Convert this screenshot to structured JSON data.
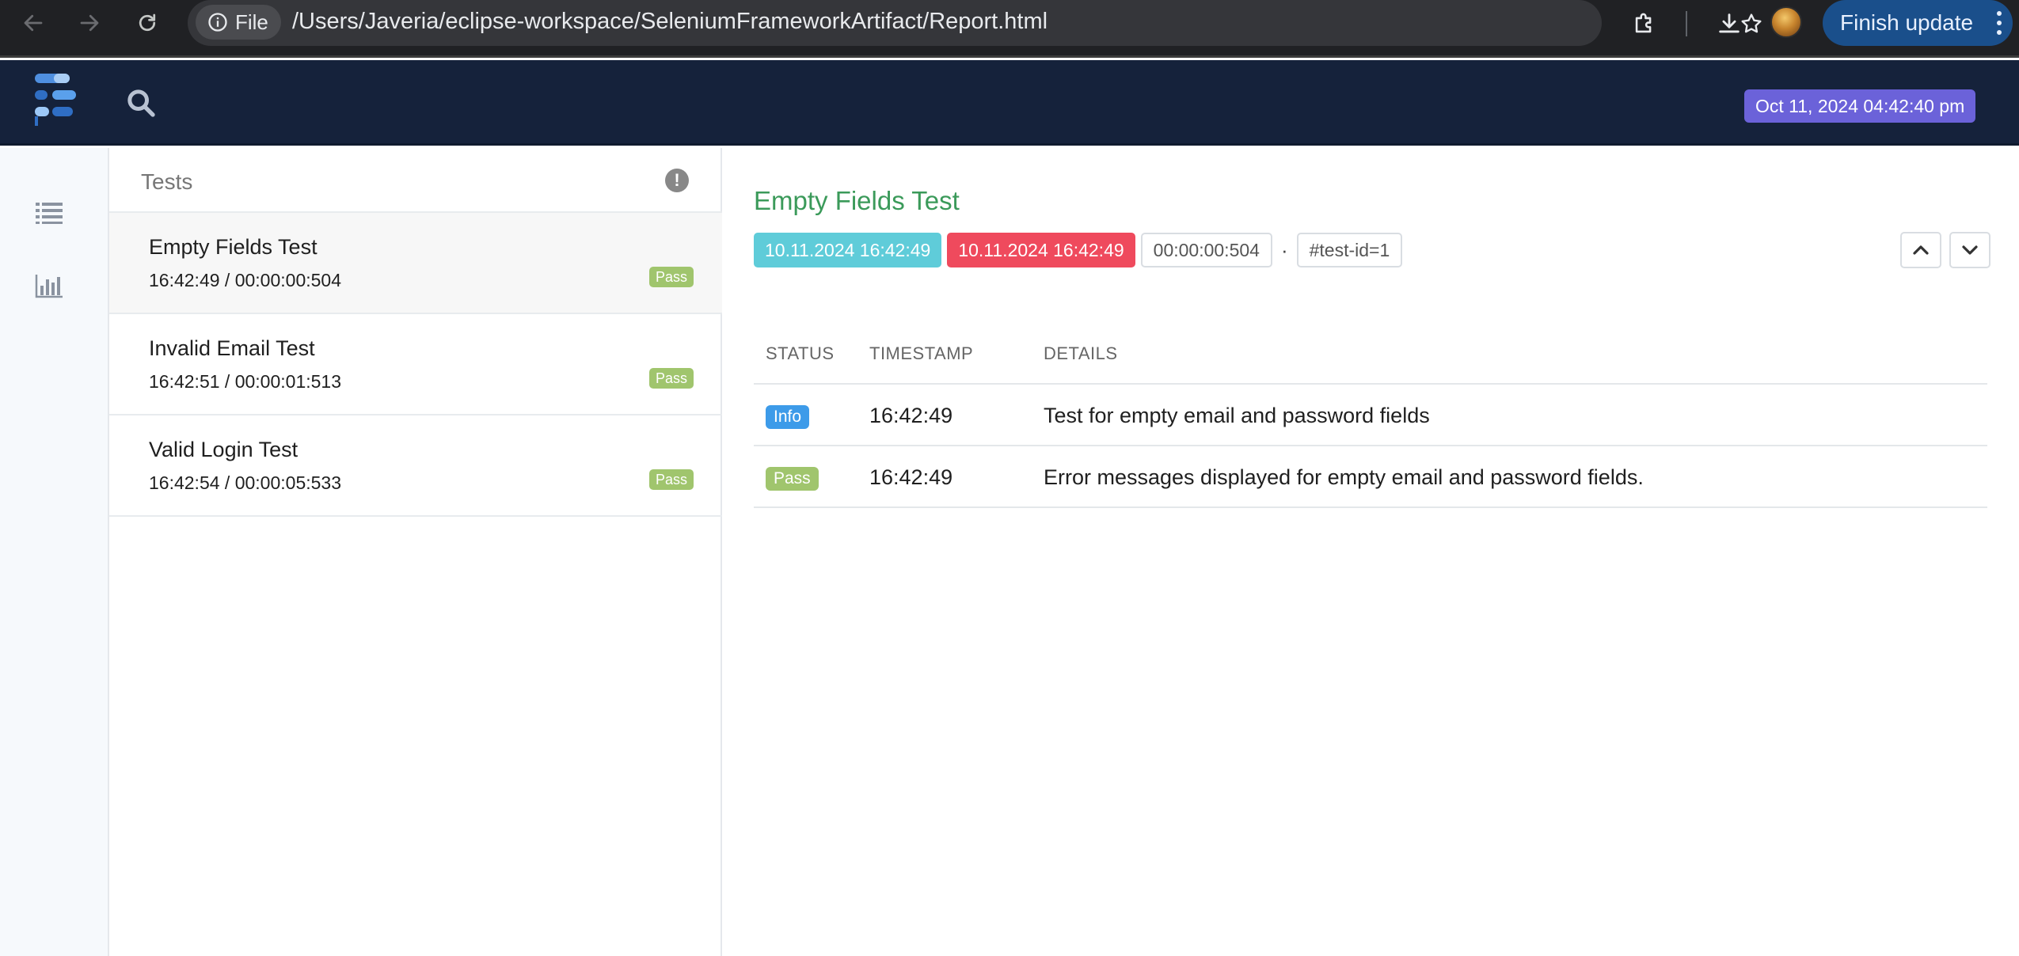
{
  "browser": {
    "file_chip_label": "File",
    "url": "/Users/Javeria/eclipse-workspace/SeleniumFrameworkArtifact/Report.html",
    "finish_update_label": "Finish update"
  },
  "header": {
    "date": "Oct 11, 2024 04:42:40 pm"
  },
  "tests_panel": {
    "title": "Tests",
    "items": [
      {
        "name": "Empty Fields Test",
        "meta": "16:42:49 / 00:00:00:504",
        "status": "Pass"
      },
      {
        "name": "Invalid Email Test",
        "meta": "16:42:51 / 00:00:01:513",
        "status": "Pass"
      },
      {
        "name": "Valid Login Test",
        "meta": "16:42:54 / 00:00:05:533",
        "status": "Pass"
      }
    ]
  },
  "detail": {
    "title": "Empty Fields Test",
    "start_time": "10.11.2024 16:42:49",
    "end_time": "10.11.2024 16:42:49",
    "duration": "00:00:00:504",
    "separator": "·",
    "test_id": "#test-id=1",
    "columns": {
      "status": "STATUS",
      "timestamp": "TIMESTAMP",
      "details": "DETAILS"
    },
    "logs": [
      {
        "status": "Info",
        "timestamp": "16:42:49",
        "details": "Test for empty email and password fields"
      },
      {
        "status": "Pass",
        "timestamp": "16:42:49",
        "details": "Error messages displayed for empty email and password fields."
      }
    ]
  },
  "colors": {
    "header_bg": "#15223b",
    "date_badge": "#6b62d9",
    "pass": "#a0c56d",
    "info": "#3d9be9",
    "start_chip": "#5fccd9",
    "end_chip": "#ef4a5d",
    "title_green": "#3b9a5a"
  },
  "icons": {
    "back": "arrow-left-icon",
    "forward": "arrow-right-icon",
    "reload": "reload-icon",
    "info": "info-circle-icon",
    "bookmark": "star-icon",
    "extensions": "puzzle-icon",
    "download": "download-icon",
    "search": "search-icon",
    "tests_view": "list-icon",
    "dashboard_view": "bar-chart-icon",
    "warning": "exclamation-icon"
  }
}
